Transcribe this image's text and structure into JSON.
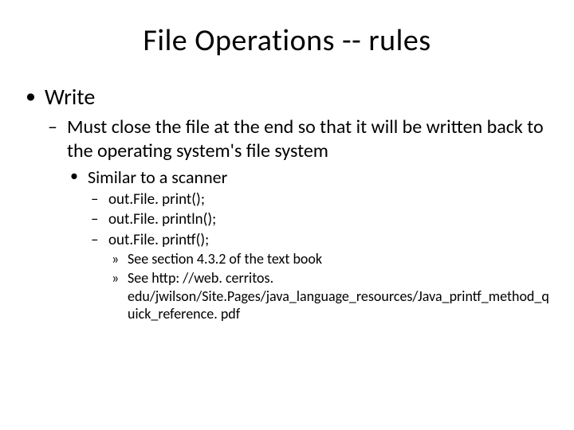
{
  "title": "File Operations -- rules",
  "bullets": {
    "l1": {
      "text": "Write",
      "l2": {
        "text": "Must close the file at the end so that it will be written back to the operating system's file system",
        "l3": {
          "text": "Similar to a scanner",
          "l4": [
            {
              "text": "out.File. print();"
            },
            {
              "text": "out.File. println();"
            },
            {
              "text": "out.File. printf();",
              "l5": [
                "See section 4.3.2 of the text book",
                "See http: //web. cerritos. edu/jwilson/Site.Pages/java_language_resources/Java_printf_method_quick_reference. pdf"
              ]
            }
          ]
        }
      }
    }
  }
}
